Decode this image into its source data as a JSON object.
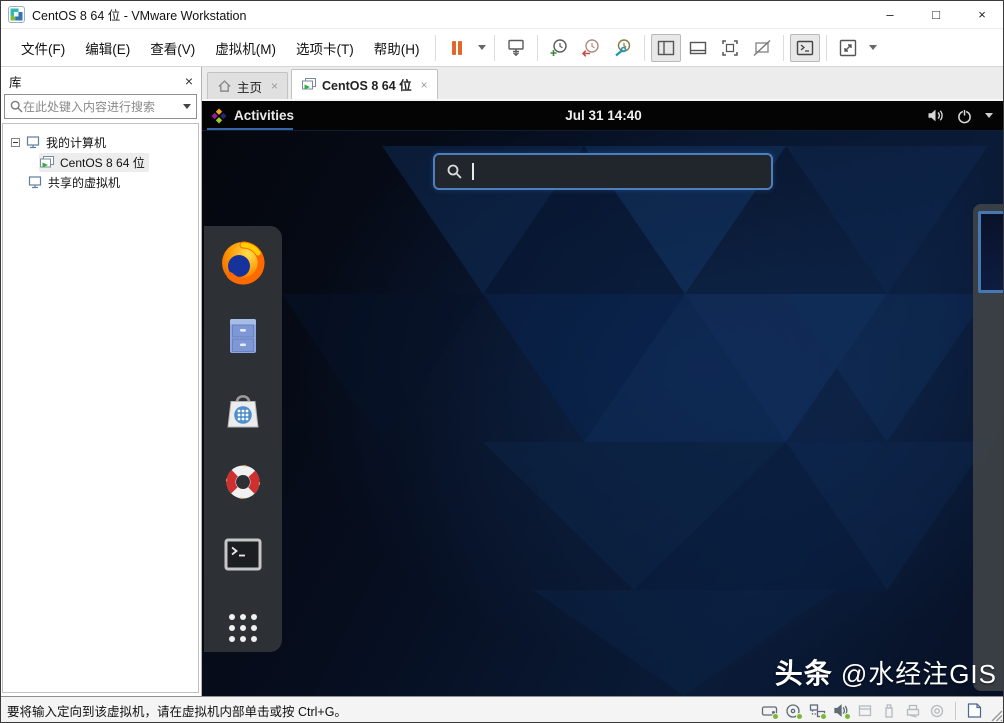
{
  "window": {
    "title": "CentOS 8 64 位 - VMware Workstation",
    "minimize": "–",
    "maximize": "□",
    "close": "×"
  },
  "menubar": {
    "items": [
      "文件(F)",
      "编辑(E)",
      "查看(V)",
      "虚拟机(M)",
      "选项卡(T)",
      "帮助(H)"
    ]
  },
  "toolbar": {
    "icon_names": [
      "pause",
      "pause-dropdown",
      "send-input-to-vm",
      "take-snapshot",
      "revert-snapshot",
      "manage-snapshots",
      "show-library",
      "show-thumbnail-bar",
      "fullscreen",
      "unity-mode",
      "console-view",
      "fit-guest",
      "fit-dropdown"
    ]
  },
  "library": {
    "title": "库",
    "close": "×",
    "search_placeholder": "在此处键入内容进行搜索",
    "tree": [
      {
        "label": "我的计算机"
      },
      {
        "label": "CentOS 8 64 位"
      },
      {
        "label": "共享的虚拟机"
      }
    ]
  },
  "tabs": [
    {
      "label": "主页"
    },
    {
      "label": "CentOS 8 64 位"
    }
  ],
  "tab_close": "×",
  "vm": {
    "activities_label": "Activities",
    "clock": "Jul 31 14:40",
    "dock_items": [
      "firefox",
      "files",
      "software",
      "help",
      "terminal",
      "app-grid"
    ],
    "watermark_bold": "头条",
    "watermark_rest": "@水经注GIS"
  },
  "statusbar": {
    "message": "要将输入定向到该虚拟机，请在虚拟机内部单击或按 Ctrl+G。",
    "device_icons": [
      "hard-disk",
      "cd-rom",
      "network",
      "sound",
      "floppy",
      "usb",
      "printer",
      "disc",
      "notifications"
    ]
  },
  "colors": {
    "accent_blue": "#3465a4",
    "search_border": "#4d7fbe",
    "pause_orange": "#e0662a",
    "status_green": "#7cb82f",
    "dock_bg": "#2d3035",
    "desktop_base": "#060c1a"
  }
}
